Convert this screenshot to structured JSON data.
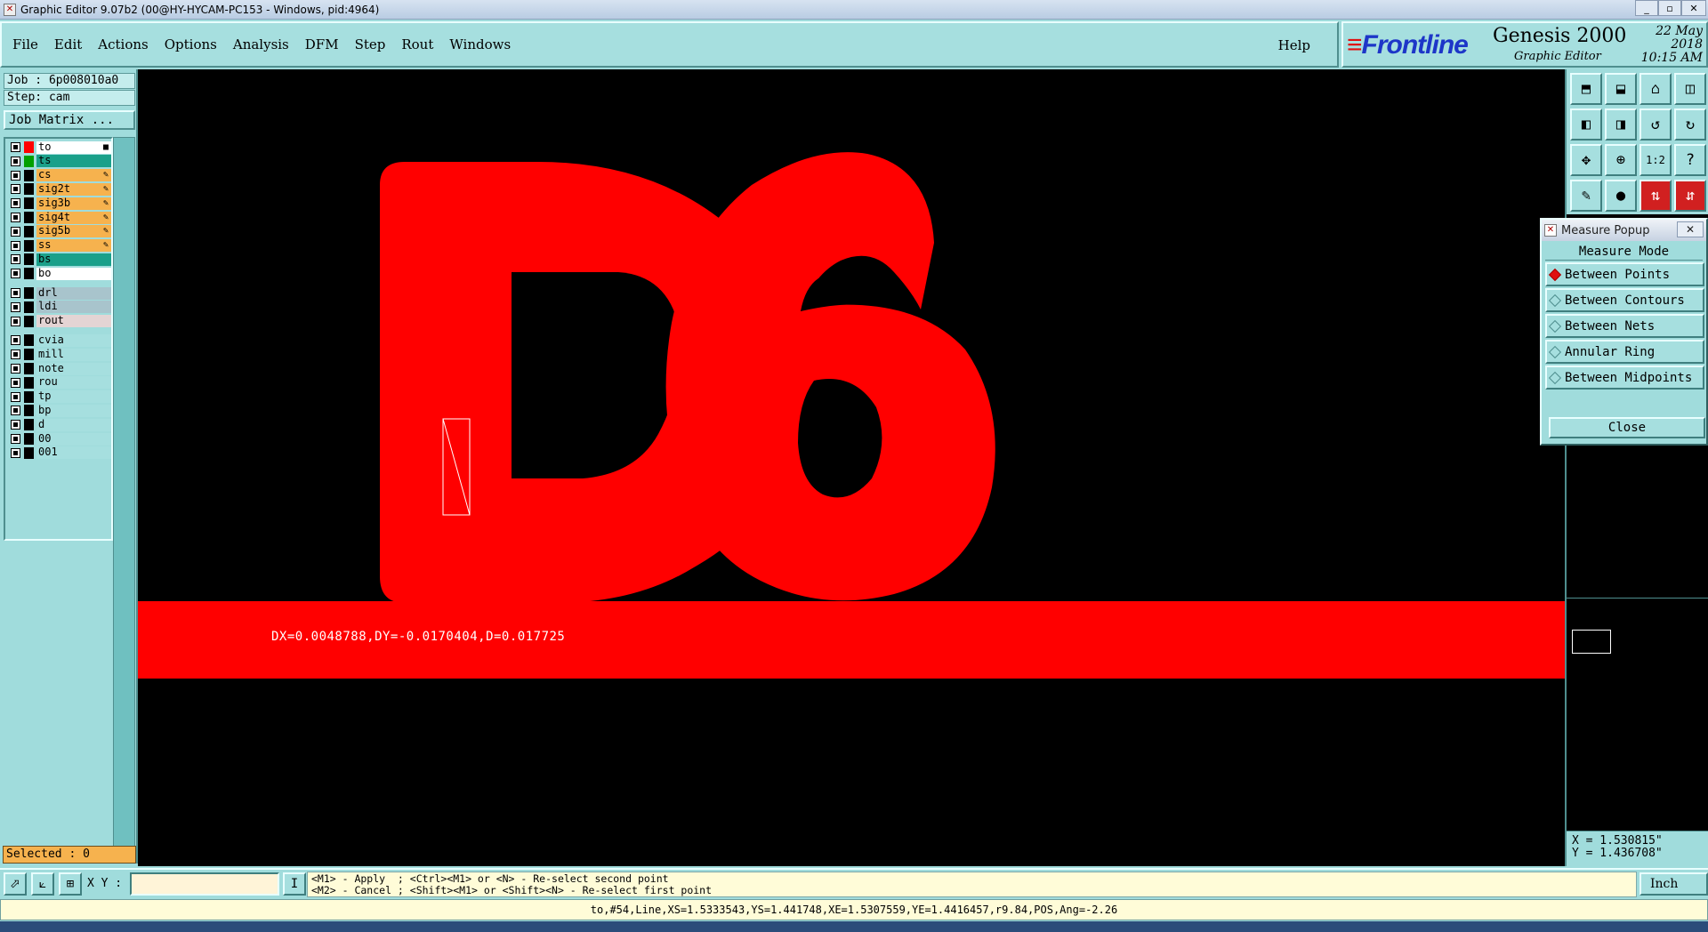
{
  "window": {
    "title": "Graphic Editor 9.07b2 (00@HY-HYCAM-PC153 - Windows, pid:4964)"
  },
  "menu": {
    "items": [
      "File",
      "Edit",
      "Actions",
      "Options",
      "Analysis",
      "DFM",
      "Step",
      "Rout",
      "Windows"
    ],
    "help": "Help"
  },
  "brand": {
    "logo": "Frontline",
    "product": "Genesis 2000",
    "subtitle": "Graphic Editor",
    "date": "22 May 2018",
    "time": "10:15 AM"
  },
  "left": {
    "job": "Job : 6p008010a0",
    "step": "Step: cam",
    "job_matrix": "Job Matrix ...",
    "layers": [
      {
        "name": "to",
        "swatch": "#ff0000",
        "color": "#ffffff",
        "edit": true
      },
      {
        "name": "ts",
        "swatch": "#00a000",
        "color": "#1aa08a",
        "edit": false
      },
      {
        "name": "cs",
        "swatch": "#000000",
        "color": "#f6b24e",
        "edit": true
      },
      {
        "name": "sig2t",
        "swatch": "#000000",
        "color": "#f6b24e",
        "edit": true
      },
      {
        "name": "sig3b",
        "swatch": "#000000",
        "color": "#f6b24e",
        "edit": true
      },
      {
        "name": "sig4t",
        "swatch": "#000000",
        "color": "#f6b24e",
        "edit": true
      },
      {
        "name": "sig5b",
        "swatch": "#000000",
        "color": "#f6b24e",
        "edit": true
      },
      {
        "name": "ss",
        "swatch": "#000000",
        "color": "#f6b24e",
        "edit": true
      },
      {
        "name": "bs",
        "swatch": "#000000",
        "color": "#1aa08a",
        "edit": false
      },
      {
        "name": "bo",
        "swatch": "#000000",
        "color": "#ffffff",
        "edit": false
      },
      {
        "name": "drl",
        "swatch": "#000000",
        "color": "#a8c4cc",
        "edit": false
      },
      {
        "name": "ldi",
        "swatch": "#000000",
        "color": "#a8c4cc",
        "edit": false
      },
      {
        "name": "rout",
        "swatch": "#000000",
        "color": "#e4d4d4",
        "edit": false
      },
      {
        "name": "cvia",
        "swatch": "#000000",
        "color": "#a6dfdf",
        "edit": false
      },
      {
        "name": "mill",
        "swatch": "#000000",
        "color": "#a6dfdf",
        "edit": false
      },
      {
        "name": "note",
        "swatch": "#000000",
        "color": "#a6dfdf",
        "edit": false
      },
      {
        "name": "rou",
        "swatch": "#000000",
        "color": "#a6dfdf",
        "edit": false
      },
      {
        "name": "tp",
        "swatch": "#000000",
        "color": "#a6dfdf",
        "edit": false
      },
      {
        "name": "bp",
        "swatch": "#000000",
        "color": "#a6dfdf",
        "edit": false
      },
      {
        "name": "d",
        "swatch": "#000000",
        "color": "#a6dfdf",
        "edit": false
      },
      {
        "name": "00",
        "swatch": "#000000",
        "color": "#a6dfdf",
        "edit": false
      },
      {
        "name": "001",
        "swatch": "#000000",
        "color": "#a6dfdf",
        "edit": false
      }
    ],
    "selected": "Selected : 0"
  },
  "canvas": {
    "text": "D6",
    "color": "#ff0000",
    "measure_readout": "DX=0.0048788,DY=-0.0170404,D=0.017725"
  },
  "toolbar": {
    "icons": [
      "zoom-home-icon",
      "zoom-in-icon",
      "home-icon",
      "split-view-icon",
      "pan-left-icon",
      "pan-right-icon",
      "undo-icon",
      "redo-icon",
      "fit-icon",
      "center-icon",
      "scale-icon",
      "help-icon",
      "snap-icon",
      "pin-icon",
      "layers-up-icon",
      "layers-down-icon"
    ],
    "glyphs": [
      "⬒",
      "⬓",
      "⌂",
      "◫",
      "◧",
      "◨",
      "↺",
      "↻",
      "✥",
      "⊕",
      "1:2",
      "?",
      "✎",
      "●",
      "⇅",
      "⇵"
    ]
  },
  "measure_popup": {
    "title": "Measure Popup",
    "mode_label": "Measure Mode",
    "options": [
      "Between Points",
      "Between Contours",
      "Between Nets",
      "Annular Ring",
      "Between Midpoints"
    ],
    "selected_index": 0,
    "close": "Close"
  },
  "coords": {
    "x": "X = 1.530815\"",
    "y": "Y = 1.436708\""
  },
  "bottom": {
    "xy_label": "X Y :",
    "xy_value": "",
    "prompt_line1": "<M1> - Apply  ; <Ctrl><M1> or <N> - Re-select second point",
    "prompt_line2": "<M2> - Cancel ; <Shift><M1> or <Shift><N> - Re-select first point",
    "units": "Inch",
    "status": "to,#54,Line,XS=1.5333543,YS=1.441748,XE=1.5307559,YE=1.4416457,r9.84,POS,Ang=-2.26"
  }
}
